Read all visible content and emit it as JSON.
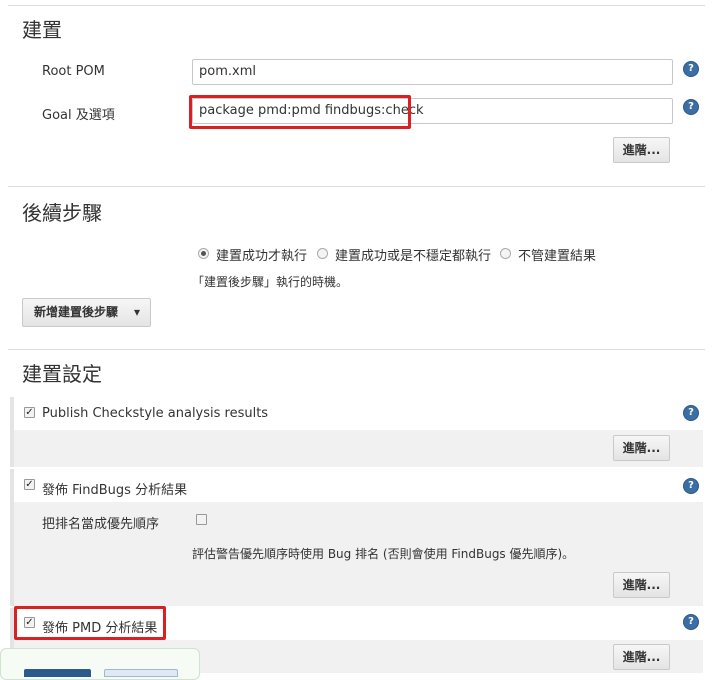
{
  "build": {
    "title": "建置",
    "root_pom_label": "Root POM",
    "root_pom_value": "pom.xml",
    "goals_label": "Goal 及選項",
    "goals_value": "package pmd:pmd findbugs:check",
    "advanced_label": "進階..."
  },
  "post_steps": {
    "title": "後續步驟",
    "options": [
      "建置成功才執行",
      "建置成功或是不穩定都執行",
      "不管建置結果"
    ],
    "selected_index": 0,
    "hint": "「建置後步驟」執行的時機。",
    "add_button_label": "新增建置後步驟"
  },
  "build_settings": {
    "title": "建置設定",
    "checkstyle": {
      "label": "Publish Checkstyle analysis results",
      "checked": true,
      "advanced_label": "進階..."
    },
    "findbugs": {
      "label": "發佈 FindBugs 分析結果",
      "checked": true,
      "rank_label": "把排名當成優先順序",
      "rank_checked": false,
      "rank_hint": "評估警告優先順序時使用 Bug 排名 (否則會使用 FindBugs 優先順序)。",
      "advanced_label": "進階..."
    },
    "pmd": {
      "label": "發佈 PMD 分析結果",
      "checked": true,
      "advanced_label": "進階..."
    }
  },
  "icons": {
    "help": "help-icon",
    "dropdown": "caret-down-icon"
  },
  "colors": {
    "highlight": "#d92121",
    "help": "#3a6ea5"
  }
}
